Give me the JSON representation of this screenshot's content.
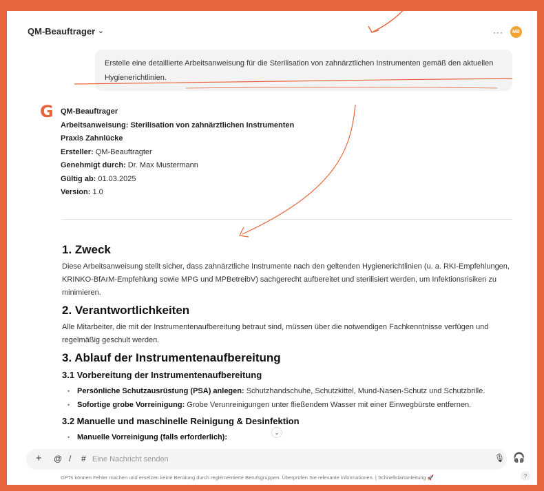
{
  "header": {
    "model_name": "QM-Beauftrager",
    "more_label": "···",
    "avatar_initials": "MB"
  },
  "user_message": "Erstelle eine detaillierte Arbeitsanweisung für die Sterilisation von zahnärztlichen Instrumenten gemäß den aktuellen Hygienerichtlinien.",
  "assistant": {
    "name": "QM-Beauftrager",
    "title": "Arbeitsanweisung: Sterilisation von zahnärztlichen Instrumenten",
    "practice": "Praxis Zahnlücke",
    "author_label": "Ersteller:",
    "author_value": "QM-Beauftragter",
    "approved_label": "Genehmigt durch:",
    "approved_value": "Dr. Max Mustermann",
    "valid_label": "Gültig ab:",
    "valid_value": "01.03.2025",
    "version_label": "Version:",
    "version_value": "1.0"
  },
  "content": {
    "s1_title": "1. Zweck",
    "s1_text": "Diese Arbeitsanweisung stellt sicher, dass zahnärztliche Instrumente nach den geltenden Hygienerichtlinien (u. a. RKI-Empfehlungen, KRINKO-BfArM-Empfehlung sowie MPG und MPBetreibV) sachgerecht aufbereitet und sterilisiert werden, um Infektionsrisiken zu minimieren.",
    "s2_title": "2. Verantwortlichkeiten",
    "s2_text": "Alle Mitarbeiter, die mit der Instrumentenaufbereitung betraut sind, müssen über die notwendigen Fachkenntnisse verfügen und regelmäßig geschult werden.",
    "s3_title": "3. Ablauf der Instrumentenaufbereitung",
    "s31_title": "3.1 Vorbereitung der Instrumentenaufbereitung",
    "s31_items": [
      {
        "bold": "Persönliche Schutzausrüstung (PSA) anlegen:",
        "text": " Schutzhandschuhe, Schutzkittel, Mund-Nasen-Schutz und Schutzbrille."
      },
      {
        "bold": "Sofortige grobe Vorreinigung:",
        "text": " Grobe Verunreinigungen unter fließendem Wasser mit einer Einwegbürste entfernen."
      }
    ],
    "s32_title": "3.2 Manuelle und maschinelle Reinigung & Desinfektion",
    "s32_items": [
      {
        "bold": "Manuelle Vorreinigung (falls erforderlich):",
        "text": ""
      }
    ]
  },
  "composer": {
    "plus": "+",
    "at": "@",
    "slash": "/",
    "hash": "#",
    "placeholder": "Eine Nachricht senden",
    "mic": "🎙",
    "headset": "🎧"
  },
  "footer": {
    "disclaimer": "GPTs können Fehler machen und ersetzen keine Beratung durch reglementierte Berufsgruppen. Überprüfen Sie relevante Informationen. | Schnellstartanleitung 🚀",
    "help": "?"
  },
  "colors": {
    "accent": "#e8643a",
    "avatar": "#f2a32f"
  }
}
